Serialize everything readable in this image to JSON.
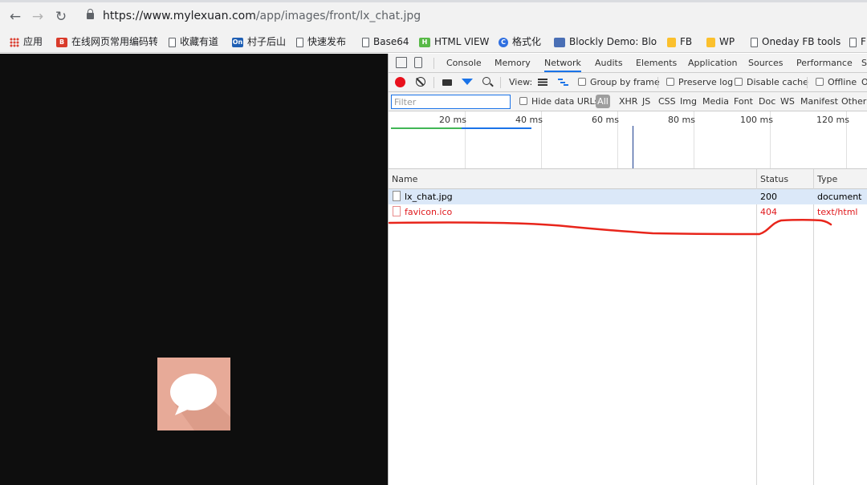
{
  "browser": {
    "url_host": "https://www.mylexuan.com",
    "url_path": "/app/images/front/lx_chat.jpg"
  },
  "bookmarks": [
    {
      "label": "应用",
      "icon": "apps-grid-icon"
    },
    {
      "label": "在线网页常用编码转",
      "icon": "red-logo-icon"
    },
    {
      "label": "收藏有道",
      "icon": "page-icon"
    },
    {
      "label": "村子后山",
      "icon": "on-badge-icon"
    },
    {
      "label": "快速发布",
      "icon": "page-icon"
    },
    {
      "label": "Base64",
      "icon": "page-icon"
    },
    {
      "label": "HTML VIEW",
      "icon": "green-logo-icon"
    },
    {
      "label": "格式化",
      "icon": "blue-c-icon"
    },
    {
      "label": "Blockly Demo: Bloc",
      "icon": "blockly-icon"
    },
    {
      "label": "FB",
      "icon": "folder-icon"
    },
    {
      "label": "WP",
      "icon": "folder-icon"
    },
    {
      "label": "Oneday FB tools",
      "icon": "page-icon"
    },
    {
      "label": "F",
      "icon": "page-icon"
    }
  ],
  "devtools": {
    "tabs": [
      "Console",
      "Memory",
      "Network",
      "Audits",
      "Elements",
      "Application",
      "Sources",
      "Performance",
      "S"
    ],
    "active_tab": "Network",
    "toolbar": {
      "view_label": "View:",
      "group_by_frame": "Group by frame",
      "preserve_log": "Preserve log",
      "disable_cache": "Disable cache",
      "offline": "Offline",
      "overflow": "O"
    },
    "filterbar": {
      "filter_placeholder": "Filter",
      "hide_data_urls": "Hide data URLs",
      "all": "All",
      "types": [
        "XHR",
        "JS",
        "CSS",
        "Img",
        "Media",
        "Font",
        "Doc",
        "WS",
        "Manifest",
        "Other"
      ]
    },
    "overview": {
      "ticks": [
        "20 ms",
        "40 ms",
        "60 ms",
        "80 ms",
        "100 ms",
        "120 ms"
      ]
    },
    "grid": {
      "columns": [
        "Name",
        "Status",
        "Type"
      ],
      "rows": [
        {
          "name": "lx_chat.jpg",
          "status": "200",
          "type": "document"
        },
        {
          "name": "favicon.ico",
          "status": "404",
          "type": "text/html"
        }
      ]
    }
  },
  "colors": {
    "accent": "#1a73e8",
    "error": "#e0181c",
    "record": "#e8101c",
    "annotation": "#e8251b",
    "viewport_bg": "#0e0e0e",
    "chat_icon_bg": "#e7aa98"
  }
}
